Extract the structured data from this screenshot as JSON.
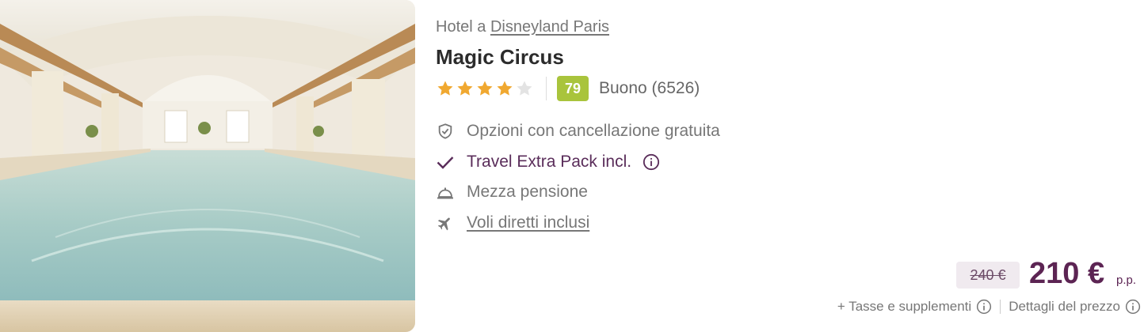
{
  "hotel": {
    "location_prefix": "Hotel a",
    "location_link": "Disneyland Paris",
    "name": "Magic Circus",
    "stars": {
      "filled": 4,
      "total": 5
    },
    "score": "79",
    "score_text": "Buono (6526)"
  },
  "features": [
    {
      "icon": "shield-check-icon",
      "label": "Opzioni con cancellazione gratuita"
    },
    {
      "icon": "checkmark-icon",
      "label": "Travel Extra Pack incl."
    },
    {
      "icon": "service-bell-icon",
      "label": "Mezza pensione"
    },
    {
      "icon": "airplane-icon",
      "label": "Voli diretti inclusi"
    }
  ],
  "price": {
    "old": "240 €",
    "current": "210 €",
    "unit": "p.p.",
    "taxes_label": "+ Tasse e supplementi",
    "details_label": "Dettagli del prezzo"
  },
  "colors": {
    "accent": "#5c2453",
    "score_badge": "#a9c43c",
    "star_filled": "#f0a830",
    "star_empty": "#e3e3e3"
  }
}
